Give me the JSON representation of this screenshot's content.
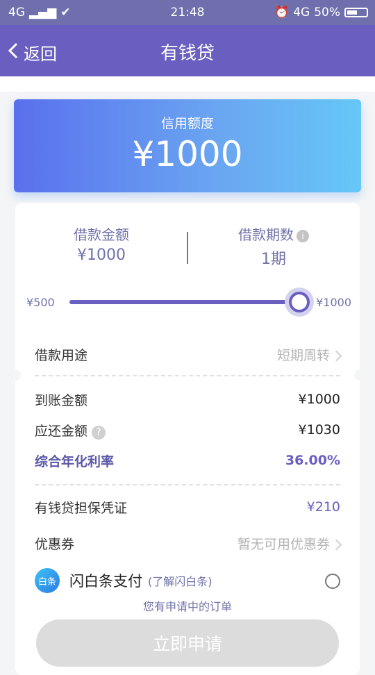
{
  "status_bar": {
    "network": "4G",
    "time": "21:48",
    "network_right": "4G",
    "battery": "50%"
  },
  "nav": {
    "back_label": "返回",
    "title": "有钱贷"
  },
  "credit": {
    "label": "信用额度",
    "amount": "¥1000"
  },
  "loan": {
    "amount_label": "借款金额",
    "amount_value": "¥1000",
    "term_label": "借款期数",
    "term_value": "1期",
    "slider_min": "¥500",
    "slider_max": "¥1000",
    "slider_level": 1.0
  },
  "purpose": {
    "label": "借款用途",
    "value": "短期周转"
  },
  "details": {
    "received_label": "到账金额",
    "received_value": "¥1000",
    "repay_label": "应还金额",
    "repay_value": "¥1030",
    "rate_label": "综合年化利率",
    "rate_value": "36.00%",
    "guarantee_label": "有钱贷担保凭证",
    "guarantee_value": "¥210",
    "coupon_label": "优惠券",
    "coupon_value": "暂无可用优惠券"
  },
  "flash_pay": {
    "logo_text": "白条",
    "title": "闪白条支付",
    "learn": "(了解闪白条)"
  },
  "pending_text": "您有申请中的订单",
  "apply_button": "立即申请",
  "colors": {
    "primary": "#6a5fc1",
    "credit_gradient_start": "#5a70ee",
    "credit_gradient_end": "#65c7f7",
    "label_text": "#6f72a8",
    "disabled_button": "#dcdcdc"
  }
}
